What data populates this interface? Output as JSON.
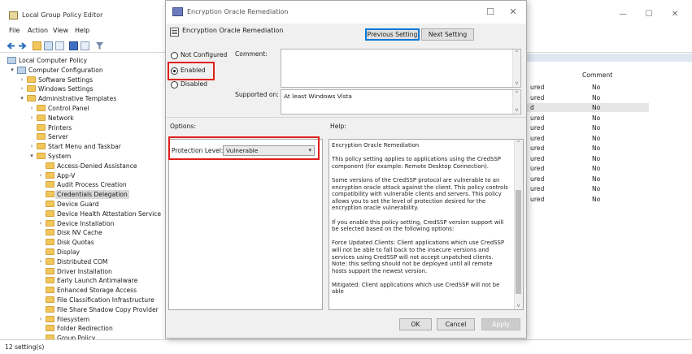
{
  "main_window": {
    "title": "Local Group Policy Editor",
    "menu": [
      "File",
      "Action",
      "View",
      "Help"
    ],
    "status": "12 setting(s)"
  },
  "tree": [
    {
      "label": "Local Computer Policy",
      "icon": "computer-icon",
      "level": 0,
      "arrow": ""
    },
    {
      "label": "Computer Configuration",
      "icon": "computer-icon",
      "level": 1,
      "arrow": "v"
    },
    {
      "label": "Software Settings",
      "icon": "folder-icon",
      "level": 2,
      "arrow": ">"
    },
    {
      "label": "Windows Settings",
      "icon": "folder-icon",
      "level": 2,
      "arrow": ">"
    },
    {
      "label": "Administrative Templates",
      "icon": "folder-icon",
      "level": 2,
      "arrow": "v"
    },
    {
      "label": "Control Panel",
      "icon": "folder-icon",
      "level": 3,
      "arrow": ">"
    },
    {
      "label": "Network",
      "icon": "folder-icon",
      "level": 3,
      "arrow": ">"
    },
    {
      "label": "Printers",
      "icon": "folder-icon",
      "level": 3,
      "arrow": ""
    },
    {
      "label": "Server",
      "icon": "folder-icon",
      "level": 3,
      "arrow": ""
    },
    {
      "label": "Start Menu and Taskbar",
      "icon": "folder-icon",
      "level": 3,
      "arrow": ">"
    },
    {
      "label": "System",
      "icon": "folder-icon",
      "level": 3,
      "arrow": "v"
    },
    {
      "label": "Access-Denied Assistance",
      "icon": "folder-icon",
      "level": 4,
      "arrow": ""
    },
    {
      "label": "App-V",
      "icon": "folder-icon",
      "level": 4,
      "arrow": ">"
    },
    {
      "label": "Audit Process Creation",
      "icon": "folder-icon",
      "level": 4,
      "arrow": ""
    },
    {
      "label": "Credentials Delegation",
      "icon": "folder-icon",
      "level": 4,
      "arrow": "",
      "selected": true
    },
    {
      "label": "Device Guard",
      "icon": "folder-icon",
      "level": 4,
      "arrow": ""
    },
    {
      "label": "Device Health Attestation Service",
      "icon": "folder-icon",
      "level": 4,
      "arrow": ""
    },
    {
      "label": "Device Installation",
      "icon": "folder-icon",
      "level": 4,
      "arrow": ">"
    },
    {
      "label": "Disk NV Cache",
      "icon": "folder-icon",
      "level": 4,
      "arrow": ""
    },
    {
      "label": "Disk Quotas",
      "icon": "folder-icon",
      "level": 4,
      "arrow": ""
    },
    {
      "label": "Display",
      "icon": "folder-icon",
      "level": 4,
      "arrow": ""
    },
    {
      "label": "Distributed COM",
      "icon": "folder-icon",
      "level": 4,
      "arrow": ">"
    },
    {
      "label": "Driver Installation",
      "icon": "folder-icon",
      "level": 4,
      "arrow": ""
    },
    {
      "label": "Early Launch Antimalware",
      "icon": "folder-icon",
      "level": 4,
      "arrow": ""
    },
    {
      "label": "Enhanced Storage Access",
      "icon": "folder-icon",
      "level": 4,
      "arrow": ""
    },
    {
      "label": "File Classification Infrastructure",
      "icon": "folder-icon",
      "level": 4,
      "arrow": ""
    },
    {
      "label": "File Share Shadow Copy Provider",
      "icon": "folder-icon",
      "level": 4,
      "arrow": ""
    },
    {
      "label": "Filesystem",
      "icon": "folder-icon",
      "level": 4,
      "arrow": ">"
    },
    {
      "label": "Folder Redirection",
      "icon": "folder-icon",
      "level": 4,
      "arrow": ""
    },
    {
      "label": "Group Policy",
      "icon": "folder-icon",
      "level": 4,
      "arrow": ""
    }
  ],
  "settings_list": {
    "comment_header": "Comment",
    "rows": [
      {
        "state": "ured",
        "comment": "No"
      },
      {
        "state": "ured",
        "comment": "No"
      },
      {
        "state": "d",
        "comment": "No",
        "highlight": true
      },
      {
        "state": "ured",
        "comment": "No"
      },
      {
        "state": "ured",
        "comment": "No"
      },
      {
        "state": "ured",
        "comment": "No"
      },
      {
        "state": "ured",
        "comment": "No"
      },
      {
        "state": "ured",
        "comment": "No"
      },
      {
        "state": "ured",
        "comment": "No"
      },
      {
        "state": "ured",
        "comment": "No"
      },
      {
        "state": "ured",
        "comment": "No"
      },
      {
        "state": "ured",
        "comment": "No"
      }
    ]
  },
  "dialog": {
    "title": "Encryption Oracle Remediation",
    "heading": "Encryption Oracle Remediation",
    "prev_button": "Previous Setting",
    "next_button": "Next Setting",
    "radios": [
      {
        "label": "Not Configured",
        "checked": false
      },
      {
        "label": "Enabled",
        "checked": true
      },
      {
        "label": "Disabled",
        "checked": false
      }
    ],
    "comment_label": "Comment:",
    "supported_label": "Supported on:",
    "supported_value": "At least Windows Vista",
    "options_label": "Options:",
    "help_label": "Help:",
    "protection_label": "Protection Level:",
    "protection_value": "Vulnerable",
    "help_paragraphs": [
      "Encryption Oracle Remediation",
      "This policy setting applies to applications using the CredSSP component (for example: Remote Desktop Connection).",
      "Some versions of the CredSSP protocol are vulnerable to an encryption oracle attack against the client.  This policy controls compatibility with vulnerable clients and servers.  This policy allows you to set the level of protection desired for the encryption oracle vulnerability.",
      "If you enable this policy setting, CredSSP version support will be selected based on the following options:",
      "Force Updated Clients: Client applications which use CredSSP will not be able to fall back to the insecure versions and services using CredSSP will not accept unpatched clients. Note: this setting should not be deployed until all remote hosts support the newest version.",
      "Mitigated: Client applications which use CredSSP will not be able"
    ],
    "ok_button": "OK",
    "cancel_button": "Cancel",
    "apply_button": "Apply"
  },
  "colors": {
    "highlight_box": "#e0201c",
    "default_button_border": "#0078d7"
  }
}
